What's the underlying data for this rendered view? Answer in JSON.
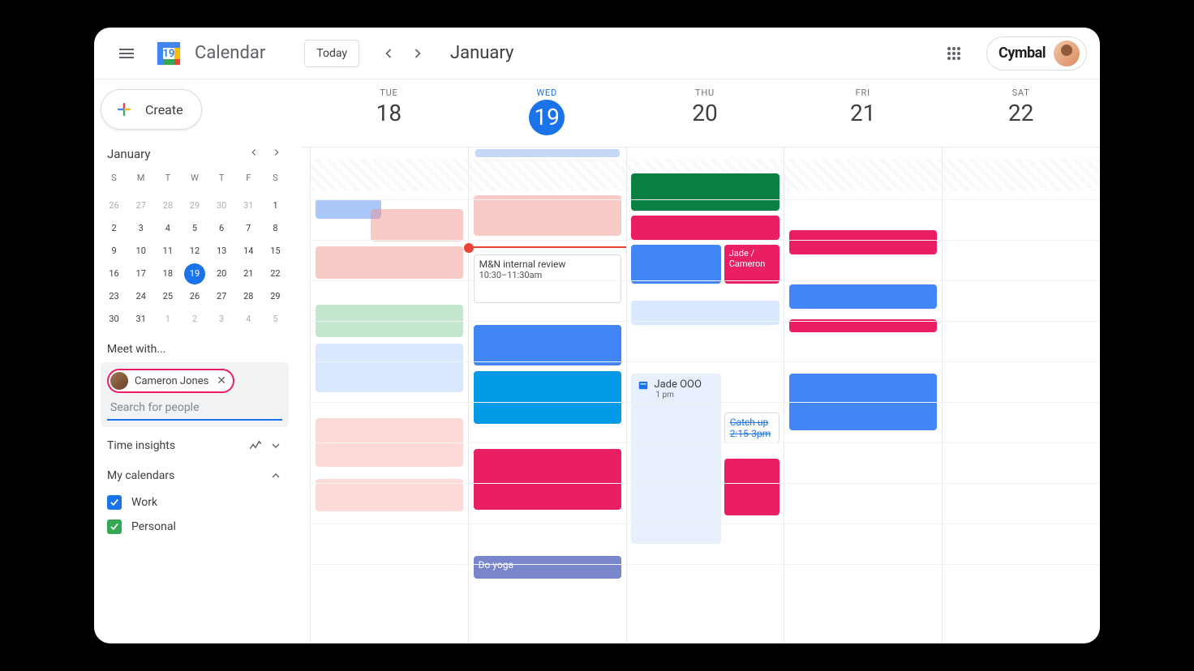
{
  "header": {
    "app_title": "Calendar",
    "logo_day": "19",
    "today_label": "Today",
    "month_label": "January",
    "brand": "Cymbal"
  },
  "sidebar": {
    "create_label": "Create",
    "mini_month": "January",
    "weekdays": [
      "S",
      "M",
      "T",
      "W",
      "T",
      "F",
      "S"
    ],
    "days": [
      {
        "n": "26",
        "o": true
      },
      {
        "n": "27",
        "o": true
      },
      {
        "n": "28",
        "o": true
      },
      {
        "n": "29",
        "o": true
      },
      {
        "n": "30",
        "o": true
      },
      {
        "n": "31",
        "o": true
      },
      {
        "n": "1"
      },
      {
        "n": "2"
      },
      {
        "n": "3"
      },
      {
        "n": "4"
      },
      {
        "n": "5"
      },
      {
        "n": "6"
      },
      {
        "n": "7"
      },
      {
        "n": "8"
      },
      {
        "n": "9"
      },
      {
        "n": "10"
      },
      {
        "n": "11"
      },
      {
        "n": "12"
      },
      {
        "n": "13"
      },
      {
        "n": "14"
      },
      {
        "n": "15"
      },
      {
        "n": "16"
      },
      {
        "n": "17"
      },
      {
        "n": "18"
      },
      {
        "n": "19",
        "t": true
      },
      {
        "n": "20"
      },
      {
        "n": "21"
      },
      {
        "n": "22"
      },
      {
        "n": "23"
      },
      {
        "n": "24"
      },
      {
        "n": "25"
      },
      {
        "n": "26"
      },
      {
        "n": "27"
      },
      {
        "n": "28"
      },
      {
        "n": "29"
      },
      {
        "n": "30"
      },
      {
        "n": "31"
      },
      {
        "n": "1",
        "o": true
      },
      {
        "n": "2",
        "o": true
      },
      {
        "n": "3",
        "o": true
      },
      {
        "n": "4",
        "o": true
      },
      {
        "n": "5",
        "o": true
      }
    ],
    "meet_label": "Meet with...",
    "chip_name": "Cameron Jones",
    "search_placeholder": "Search for people",
    "time_insights": "Time insights",
    "my_calendars": "My calendars",
    "cal_work": "Work",
    "cal_personal": "Personal",
    "color_work": "#1a73e8",
    "color_personal": "#34a853"
  },
  "main": {
    "days": [
      {
        "wd": "TUE",
        "n": "18"
      },
      {
        "wd": "WED",
        "n": "19",
        "active": true
      },
      {
        "wd": "THU",
        "n": "20"
      },
      {
        "wd": "FRI",
        "n": "21"
      },
      {
        "wd": "SAT",
        "n": "22"
      }
    ],
    "events": {
      "review_title": "M&N internal review",
      "review_time": "10:30–11:30am",
      "jade_title": "Jade / Cameron",
      "ooo_title": "Jade OOO",
      "ooo_time": "1 pm",
      "catchup_title": "Catch up",
      "catchup_time": "2:15-3pm",
      "yoga_title": "Do yoga"
    }
  }
}
